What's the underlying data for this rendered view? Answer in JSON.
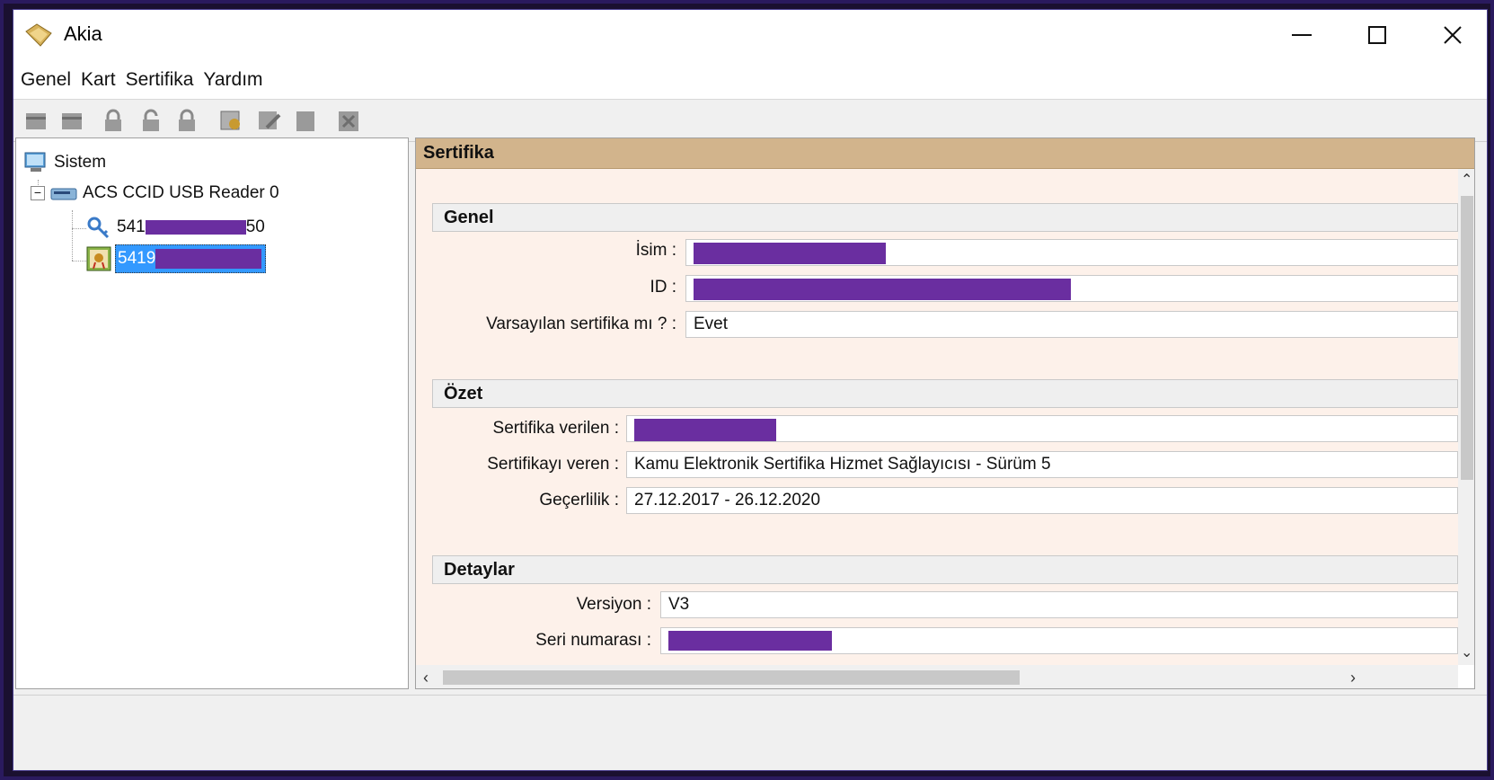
{
  "window": {
    "title": "Akia",
    "minimize_icon": "minimize-icon",
    "maximize_icon": "maximize-icon",
    "close_icon": "close-icon"
  },
  "menu": [
    "Genel",
    "Kart",
    "Sertifika",
    "Yardım"
  ],
  "toolbar_icons": [
    "card-icon",
    "card-icon",
    "lock-icon",
    "lock-open-icon",
    "lock-icon",
    "certificate-icon",
    "certificate-edit-icon",
    "card-icon",
    "delete-icon"
  ],
  "tree": {
    "root": "Sistem",
    "reader": "ACS CCID USB Reader 0",
    "key_item_prefix": "541",
    "key_item_suffix": "50",
    "cert_item_prefix": "5419"
  },
  "panel": {
    "title": "Sertifika",
    "sections": {
      "general": "Genel",
      "summary": "Özet",
      "details": "Detaylar"
    },
    "fields": {
      "name_label": "İsim :",
      "id_label": "ID :",
      "default_label": "Varsayılan sertifika mı ? :",
      "default_value": "Evet",
      "issued_to_label": "Sertifika verilen :",
      "issuer_label": "Sertifikayı veren :",
      "issuer_value": "Kamu Elektronik Sertifika Hizmet Sağlayıcısı - Sürüm 5",
      "validity_label": "Geçerlilik :",
      "validity_value": "27.12.2017 - 26.12.2020",
      "version_label": "Versiyon :",
      "version_value": "V3",
      "serial_label": "Seri numarası :"
    }
  },
  "colors": {
    "header_bg": "#d2b48c",
    "content_bg": "#fdf1ea",
    "redaction": "#6a2ea0",
    "selection": "#3399ff"
  }
}
